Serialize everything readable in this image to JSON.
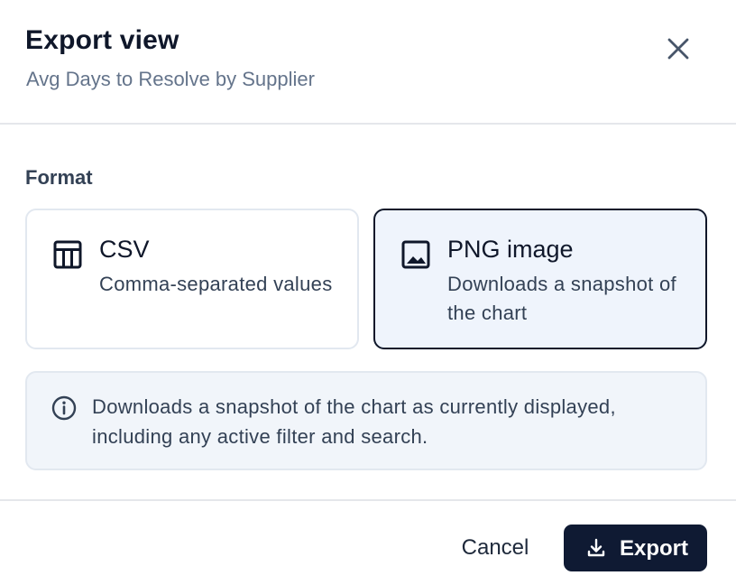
{
  "dialog": {
    "title": "Export view",
    "subtitle": "Avg Days to Resolve by Supplier",
    "close_icon": "close-icon"
  },
  "format": {
    "label": "Format",
    "selected": "png",
    "options": [
      {
        "id": "csv",
        "title": "CSV",
        "description": "Comma-separated values",
        "icon": "table-icon",
        "selected": false
      },
      {
        "id": "png",
        "title": "PNG image",
        "description": "Downloads a snapshot of the chart",
        "icon": "image-icon",
        "selected": true
      }
    ]
  },
  "info": {
    "icon": "info-icon",
    "text": "Downloads a snapshot of the chart as currently displayed, including any active filter and search."
  },
  "footer": {
    "cancel_label": "Cancel",
    "export_label": "Export",
    "export_icon": "download-icon"
  },
  "colors": {
    "primary": "#0f1a33",
    "selected_background": "#eff4fc",
    "info_background": "#f1f5fa",
    "muted_text": "#64748b",
    "border": "#e2e8f0"
  }
}
